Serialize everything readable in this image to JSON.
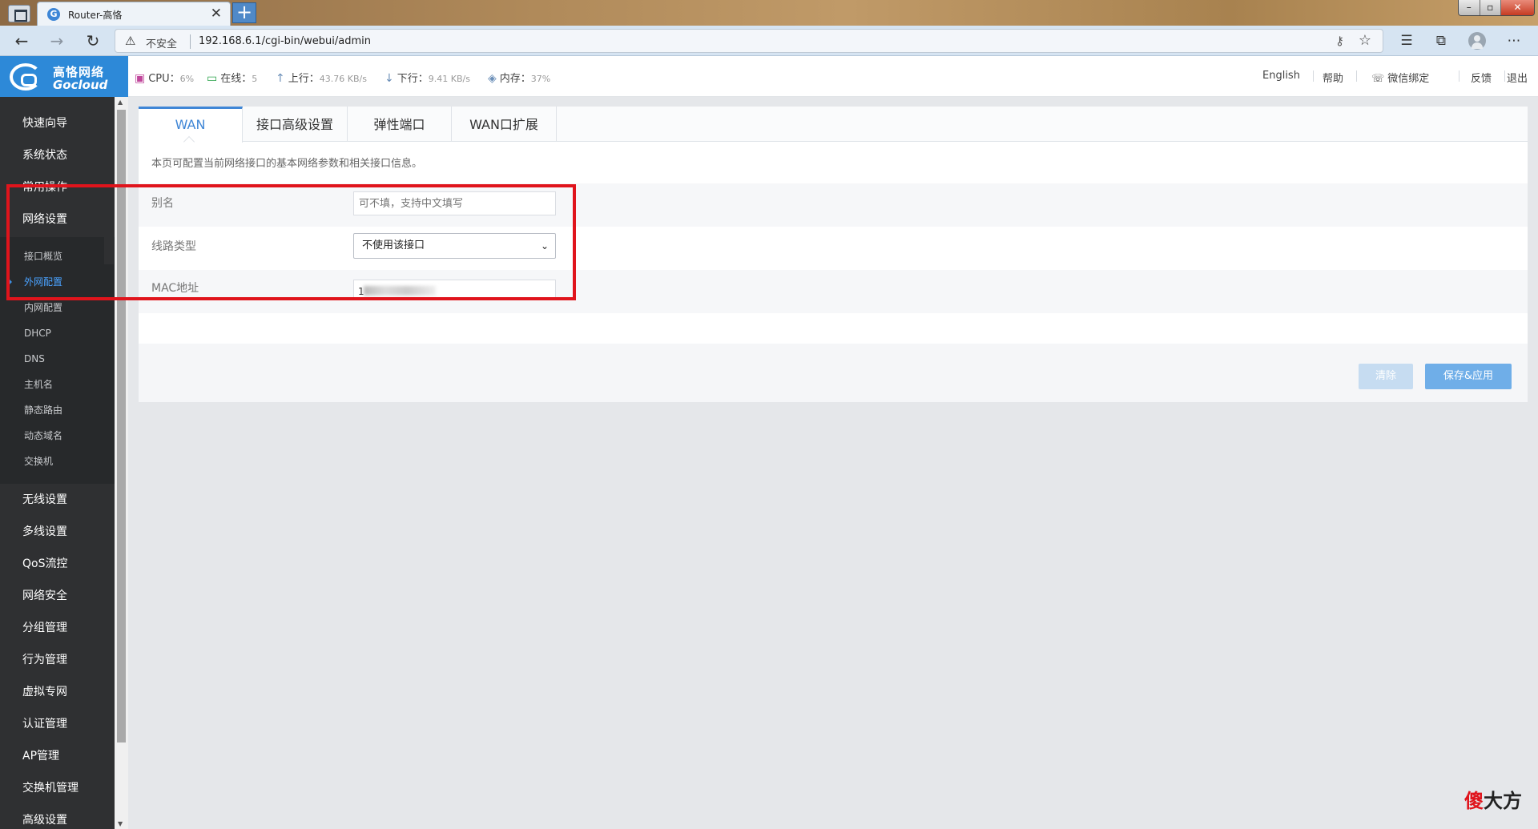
{
  "browser": {
    "tab_title": "Router-高恪",
    "tab_close": "✕",
    "new_tab": "+",
    "window_controls": [
      "–",
      "▫",
      "✕"
    ],
    "insecure_label": "不安全",
    "url": "192.168.6.1/cgi-bin/webui/admin",
    "icons": [
      "back-icon",
      "forward-icon",
      "refresh-icon",
      "warning-icon",
      "key-icon",
      "favorite-star-icon",
      "favorites-icon",
      "collections-icon",
      "profile-icon",
      "more-icon"
    ]
  },
  "logo": {
    "cn": "高恪网络",
    "en": "Gocloud"
  },
  "header": {
    "cpu_label": "CPU：",
    "cpu_value": "6%",
    "online_label": "在线：",
    "online_value": "5",
    "up_label": "上行：",
    "up_value": "43.76 KB/s",
    "down_label": "下行：",
    "down_value": "9.41 KB/s",
    "mem_label": "内存：",
    "mem_value": "37%",
    "links": {
      "english": "English",
      "help": "帮助",
      "wechat": "微信绑定",
      "feedback": "反馈",
      "logout": "退出"
    }
  },
  "sidebar": {
    "top_items": [
      "快速向导",
      "系统状态",
      "常用操作",
      "网络设置"
    ],
    "sub_items": [
      "接口概览",
      "外网配置",
      "内网配置",
      "DHCP",
      "DNS",
      "主机名",
      "静态路由",
      "动态域名",
      "交换机"
    ],
    "active_sub": "外网配置",
    "bottom_items": [
      "无线设置",
      "多线设置",
      "QoS流控",
      "网络安全",
      "分组管理",
      "行为管理",
      "虚拟专网",
      "认证管理",
      "AP管理",
      "交换机管理",
      "高级设置"
    ]
  },
  "main": {
    "tabs": [
      "WAN",
      "接口高级设置",
      "弹性端口",
      "WAN口扩展"
    ],
    "active_tab": "WAN",
    "description": "本页可配置当前网络接口的基本网络参数和相关接口信息。",
    "fields": {
      "alias_label": "别名",
      "alias_placeholder": "可不填，支持中文填写",
      "line_type_label": "线路类型",
      "line_type_value": "不使用该接口",
      "mac_label": "MAC地址",
      "mac_visible": "1"
    },
    "buttons": {
      "clear": "清除",
      "save": "保存&应用"
    }
  },
  "watermark": {
    "part1": "傻",
    "part2": "大方"
  },
  "colors": {
    "accent": "#3f86d6",
    "sidebar_bg": "#2f3032",
    "highlight": "#e0141c",
    "logo_bg": "#2d89d8"
  }
}
